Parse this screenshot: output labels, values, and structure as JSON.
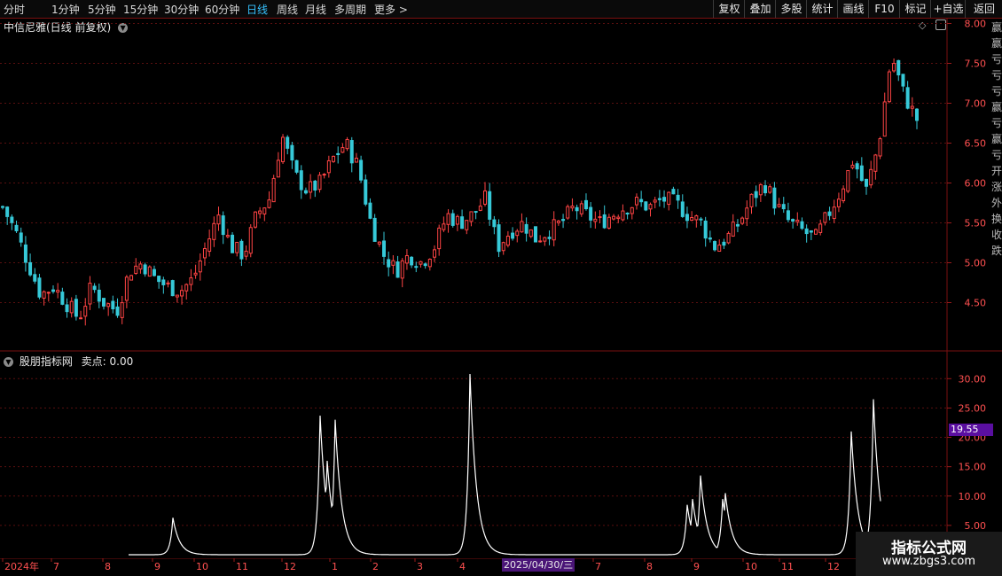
{
  "toolbar": {
    "timeframes": [
      "分时",
      "1分钟",
      "5分钟",
      "15分钟",
      "30分钟",
      "60分钟",
      "日线",
      "周线",
      "月线",
      "多周期",
      "更多 >"
    ],
    "active_timeframe": "日线",
    "tools": [
      "复权",
      "叠加",
      "多股",
      "统计",
      "画线",
      "F10",
      "标记",
      "+自选",
      "返回"
    ]
  },
  "main_chart": {
    "title": "中信尼雅(日线 前复权)",
    "y_ticks": [
      "8.00",
      "7.50",
      "7.00",
      "6.50",
      "6.00",
      "5.50",
      "5.00",
      "4.50"
    ],
    "up_color": "#ff4444",
    "down_color": "#36c9d8"
  },
  "indicator": {
    "title": "股朋指标网",
    "label": "卖点:",
    "value": "0.00",
    "y_ticks": [
      "30.00",
      "25.00",
      "20.00",
      "15.00",
      "10.00",
      "5.00"
    ],
    "marker_value": "19.55"
  },
  "x_axis": {
    "labels": [
      "2024年",
      "7",
      "8",
      "9",
      "10",
      "11",
      "12",
      "1",
      "2",
      "3",
      "4",
      "2025/04/30/三",
      "7",
      "8",
      "9",
      "10",
      "11",
      "12",
      "1"
    ]
  },
  "side_strip": [
    "赢",
    "赢",
    "亏",
    "亏",
    "亏",
    "赢",
    "亏",
    "赢",
    "亏",
    "开",
    "涨",
    "外",
    "换",
    "收",
    "跌"
  ],
  "watermark": {
    "line1": "指标公式网",
    "line2": "www.zbgs3.com"
  },
  "chart_data": [
    {
      "type": "candlestick",
      "title": "中信尼雅(日线 前复权)",
      "ylim": [
        4.0,
        8.1
      ],
      "y_ticks": [
        8.0,
        7.5,
        7.0,
        6.5,
        6.0,
        5.5,
        5.0,
        4.5
      ],
      "x_range": [
        "2024-06",
        "2025-01"
      ],
      "approx_close_path": [
        5.7,
        5.4,
        5.0,
        4.6,
        4.7,
        4.5,
        4.3,
        4.7,
        4.5,
        4.4,
        4.9,
        5.0,
        4.8,
        4.7,
        4.65,
        4.8,
        5.2,
        5.6,
        5.2,
        5.1,
        5.6,
        5.8,
        6.6,
        6.1,
        5.9,
        6.0,
        6.3,
        6.5,
        6.2,
        5.5,
        5.1,
        4.9,
        5.1,
        5.0,
        5.2,
        5.6,
        5.5,
        5.6,
        5.8,
        5.2,
        5.4,
        5.5,
        5.3,
        5.4,
        5.5,
        5.7,
        5.6,
        5.5,
        5.6,
        5.7,
        5.75,
        5.7,
        5.8,
        5.75,
        5.6,
        5.5,
        5.2,
        5.3,
        5.5,
        5.8,
        6.0,
        5.7,
        5.5,
        5.4,
        5.3,
        5.6,
        5.9,
        6.3,
        5.9,
        6.5,
        7.6,
        7.1,
        6.8
      ]
    },
    {
      "type": "line",
      "series": [
        {
          "name": "卖点",
          "last_value": 0.0
        }
      ],
      "ylim": [
        0,
        31
      ],
      "y_ticks": [
        30,
        25,
        20,
        15,
        10,
        5
      ],
      "peaks": [
        6.3,
        23.7,
        16.0,
        23.0,
        30.8,
        9.5,
        13.5,
        10.5,
        21.0,
        26.5
      ],
      "marker_value": 19.55
    }
  ]
}
